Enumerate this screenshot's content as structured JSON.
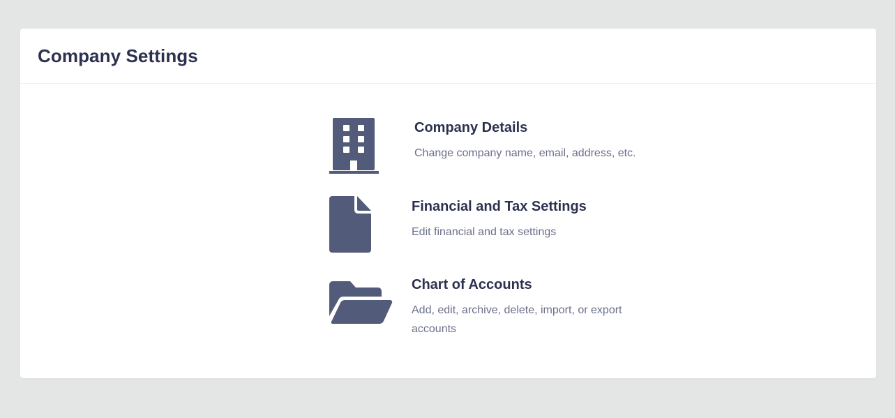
{
  "page": {
    "title": "Company Settings"
  },
  "items": [
    {
      "title": "Company Details",
      "description": "Change company name, email, address, etc.",
      "icon": "building-icon"
    },
    {
      "title": "Financial and Tax Settings",
      "description": "Edit financial and tax settings",
      "icon": "file-icon"
    },
    {
      "title": "Chart of Accounts",
      "description": "Add, edit, archive, delete, import, or export accounts",
      "icon": "folder-open-icon"
    }
  ],
  "colors": {
    "icon": "#525c7a",
    "heading": "#2d3150",
    "muted": "#6b6f8a",
    "background": "#e4e5e5",
    "card": "#ffffff"
  }
}
